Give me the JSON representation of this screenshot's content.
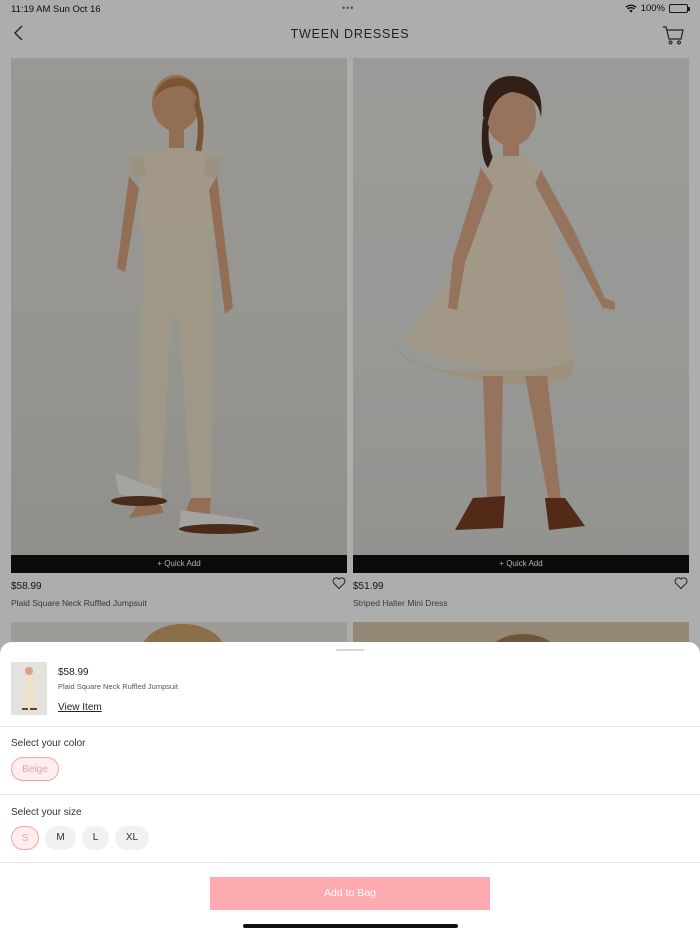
{
  "status_bar": {
    "time": "11:19 AM",
    "date": "Sun Oct 16",
    "battery": "100%"
  },
  "header": {
    "title": "TWEEN DRESSES"
  },
  "products": [
    {
      "price": "$58.99",
      "name": "Plaid Square Neck Ruffled Jumpsuit",
      "quick_add": "+ Quick Add"
    },
    {
      "price": "$51.99",
      "name": "Striped Halter Mini Dress",
      "quick_add": "+ Quick Add"
    }
  ],
  "sheet": {
    "price": "$58.99",
    "name": "Plaid Square Neck Ruffled Jumpsuit",
    "view_item": "View Item",
    "color_label": "Select your color",
    "colors": [
      "Beige"
    ],
    "selected_color": "Beige",
    "size_label": "Select your size",
    "sizes": [
      "S",
      "M",
      "L",
      "XL"
    ],
    "selected_size": "S",
    "add_to_bag": "Add to Bag"
  },
  "colors": {
    "accent": "#fdaab1",
    "accent_text": "#f2a2a8",
    "quick_add_bg": "#111111"
  }
}
